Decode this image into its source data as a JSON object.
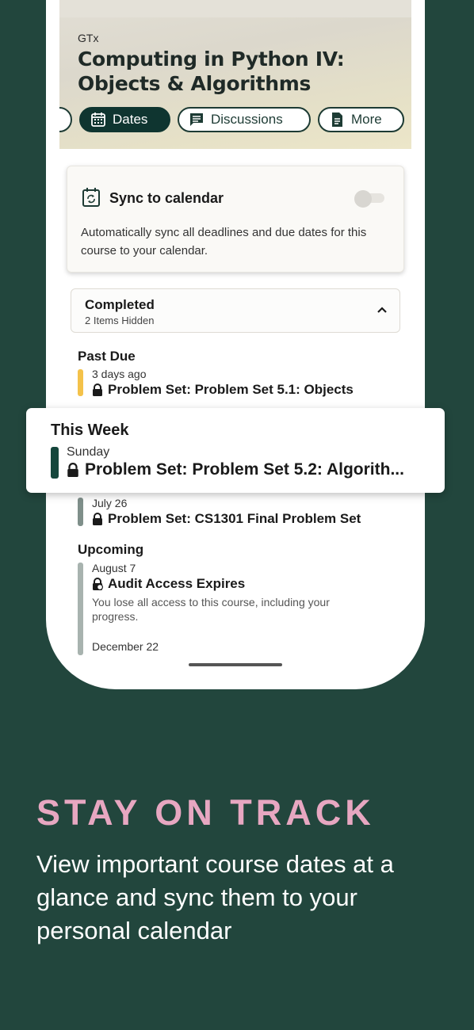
{
  "colors": {
    "background": "#22463d",
    "accent_dark": "#0f3530",
    "headline": "#e7a7c1",
    "past_due_bar": "#f4c24a",
    "this_week_bar": "#15463c",
    "later_bar": "#7f8f8a",
    "upcoming_bar": "#a8b3af"
  },
  "course": {
    "org": "GTx",
    "title": "Computing in Python IV: Objects & Algorithms"
  },
  "tabs": {
    "dates": "Dates",
    "discussions": "Discussions",
    "more": "More"
  },
  "sync": {
    "title": "Sync to calendar",
    "description": "Automatically sync all deadlines and due dates for this course to your calendar.",
    "enabled": false
  },
  "completed": {
    "title": "Completed",
    "subtitle": "2 Items Hidden"
  },
  "past_due": {
    "heading": "Past Due",
    "items": [
      {
        "date": "3 days ago",
        "title": "Problem Set: Problem Set 5.1: Objects"
      }
    ]
  },
  "this_week": {
    "heading": "This Week",
    "items": [
      {
        "date": "Sunday",
        "title": "Problem Set: Problem Set 5.2: Algorith..."
      },
      {
        "date": "July 26",
        "title": "Problem Set: CS1301 Final Problem Set"
      }
    ]
  },
  "upcoming": {
    "heading": "Upcoming",
    "items": [
      {
        "date": "August 7",
        "title": "Audit Access Expires",
        "description": "You lose all access to this course, including your progress."
      },
      {
        "date": "December 22"
      }
    ]
  },
  "marketing": {
    "headline": "STAY ON TRACK",
    "subline": "View important course dates at a glance and sync them to your personal calendar"
  }
}
